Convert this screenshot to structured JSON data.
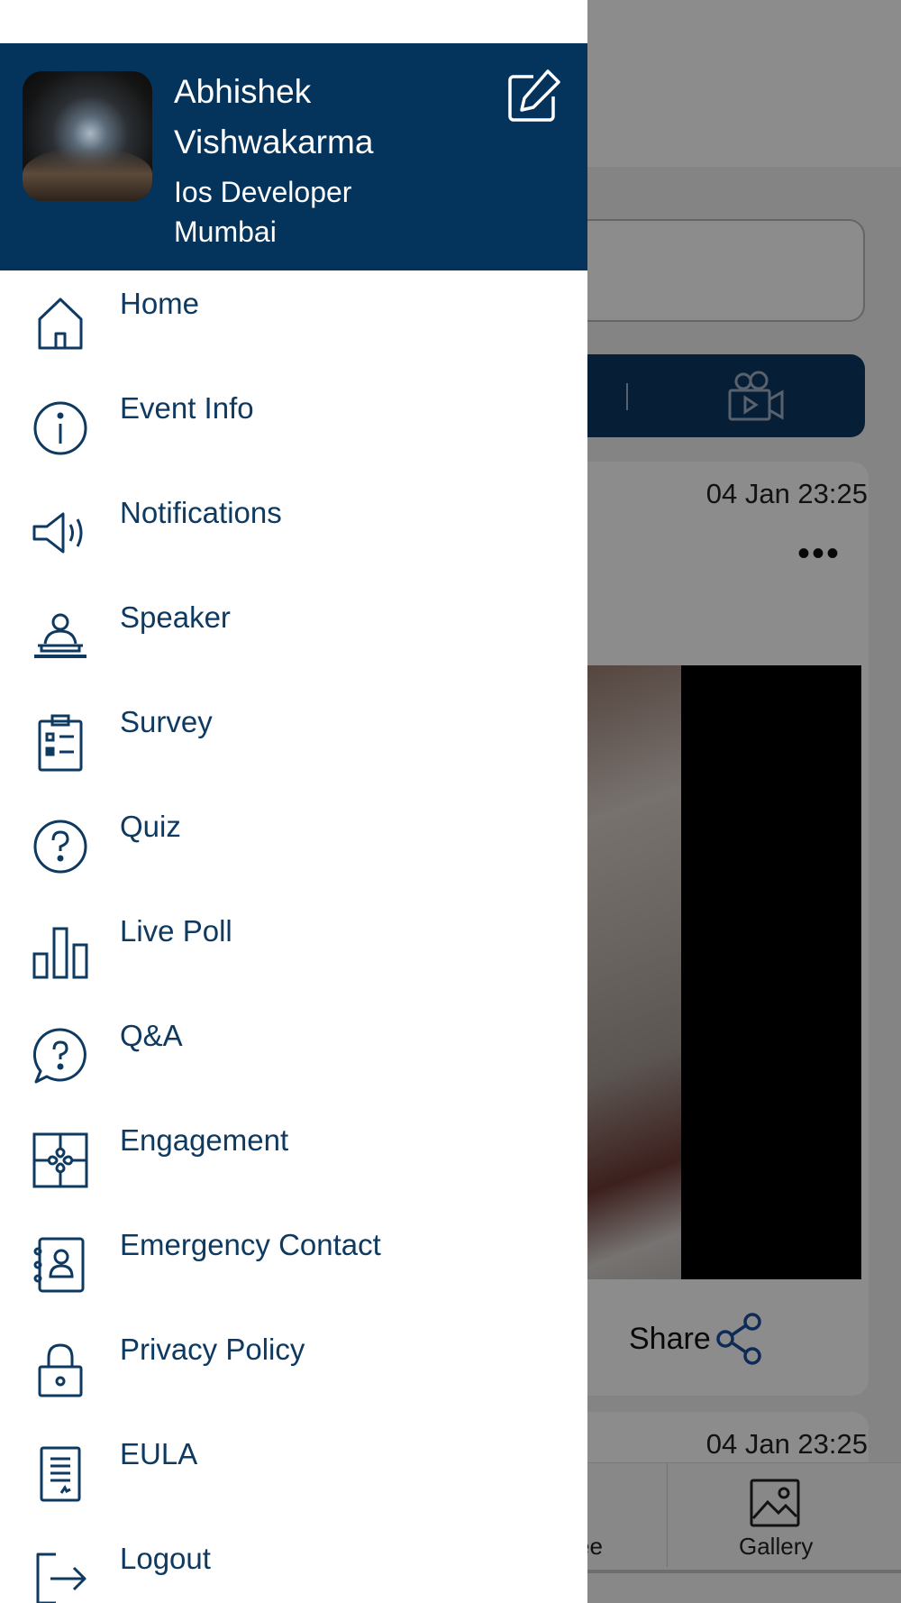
{
  "profile": {
    "name": "Abhishek Vishwakarma",
    "role": "Ios Developer",
    "city": "Mumbai"
  },
  "menu": [
    {
      "label": "Home",
      "icon": "home-icon"
    },
    {
      "label": "Event Info",
      "icon": "info-icon"
    },
    {
      "label": "Notifications",
      "icon": "megaphone-icon"
    },
    {
      "label": "Speaker",
      "icon": "speaker-podium-icon"
    },
    {
      "label": "Survey",
      "icon": "clipboard-checklist-icon"
    },
    {
      "label": "Quiz",
      "icon": "question-circle-icon"
    },
    {
      "label": "Live Poll",
      "icon": "bar-chart-icon"
    },
    {
      "label": "Q&A",
      "icon": "question-bubble-icon"
    },
    {
      "label": "Engagement",
      "icon": "puzzle-icon"
    },
    {
      "label": "Emergency Contact",
      "icon": "contact-book-icon"
    },
    {
      "label": "Privacy Policy",
      "icon": "lock-icon"
    },
    {
      "label": "EULA",
      "icon": "document-icon"
    },
    {
      "label": "Logout",
      "icon": "logout-icon"
    }
  ],
  "background": {
    "post_timestamps": [
      "04 Jan 23:25",
      "04 Jan 23:25"
    ],
    "more_label": "•••",
    "share_label": "Share",
    "tabs": [
      {
        "label": "ee"
      },
      {
        "label": "Gallery"
      }
    ]
  },
  "colors": {
    "drawer_header": "#04345c",
    "menu_text": "#0e3960",
    "media_bar": "#0d3a63"
  }
}
